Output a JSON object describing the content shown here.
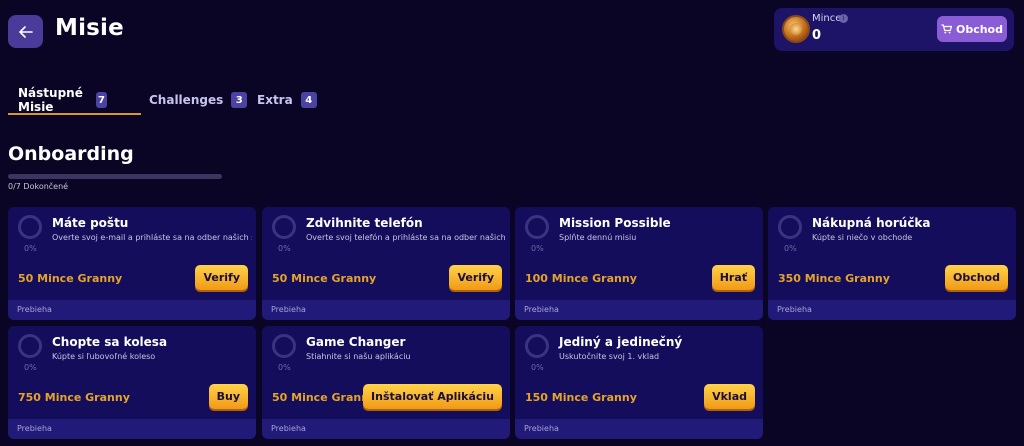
{
  "header": {
    "title": "Misie"
  },
  "wallet": {
    "label": "Mince",
    "value": "0",
    "shop_label": "Obchod"
  },
  "tabs": [
    {
      "label": "Nástupné Misie",
      "count": "7",
      "active": true
    },
    {
      "label": "Challenges",
      "count": "3",
      "active": false
    },
    {
      "label": "Extra",
      "count": "4",
      "active": false
    }
  ],
  "section": {
    "title": "Onboarding",
    "progress_text": "0/7 Dokončené",
    "progress_fraction": 0
  },
  "missions": [
    {
      "percent": "0%",
      "title": "Máte poštu",
      "desc": "Overte svoj e-mail a prihláste sa na odber našich správ",
      "reward": "50 Mince Granny",
      "button": "Verify",
      "status": "Prebieha"
    },
    {
      "percent": "0%",
      "title": "Zdvihnite telefón",
      "desc": "Overte svoj telefón a prihláste sa na odber našich správ",
      "reward": "50 Mince Granny",
      "button": "Verify",
      "status": "Prebieha"
    },
    {
      "percent": "0%",
      "title": "Mission Possible",
      "desc": "Splňte dennú misiu",
      "reward": "100 Mince Granny",
      "button": "Hrať",
      "status": "Prebieha"
    },
    {
      "percent": "0%",
      "title": "Nákupná horúčka",
      "desc": "Kúpte si niečo v obchode",
      "reward": "350 Mince Granny",
      "button": "Obchod",
      "status": "Prebieha"
    },
    {
      "percent": "0%",
      "title": "Chopte sa kolesa",
      "desc": "Kúpte si ľubovoľné koleso",
      "reward": "750 Mince Granny",
      "button": "Buy",
      "status": "Prebieha"
    },
    {
      "percent": "0%",
      "title": "Game Changer",
      "desc": "Stiahnite si našu aplikáciu",
      "reward": "50 Mince Granny",
      "button": "Inštalovať Aplikáciu",
      "status": "Prebieha"
    },
    {
      "percent": "0%",
      "title": "Jediný a jedinečný",
      "desc": "Uskutočnite svoj 1. vklad",
      "reward": "150 Mince Granny",
      "button": "Vklad",
      "status": "Prebieha"
    }
  ]
}
